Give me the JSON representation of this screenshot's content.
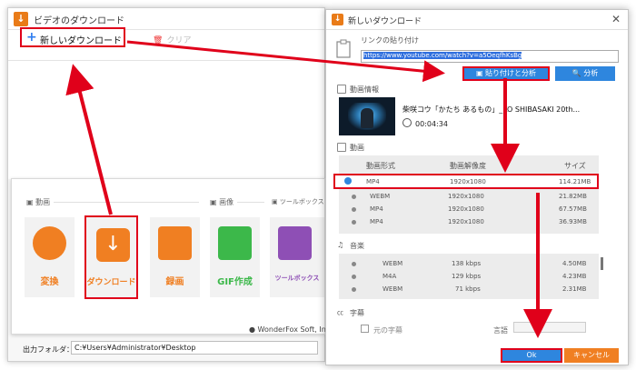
{
  "app_window": {
    "title": "ビデオのダウンロード",
    "toolbar": {
      "new_download": "新しいダウンロード",
      "clear": "クリア"
    },
    "sections": {
      "video": "動画",
      "image": "画像",
      "toolbox": "ツールボックス"
    },
    "tiles": [
      {
        "label": "変換"
      },
      {
        "label": "ダウンロード"
      },
      {
        "label": "録画"
      },
      {
        "label": "GIF作成"
      },
      {
        "label": "ツールボックス"
      }
    ],
    "credit": "WonderFox Soft, In",
    "output_folder_label": "出力フォルダ：",
    "output_folder_value": "C:¥Users¥Administrator¥Desktop"
  },
  "dialog": {
    "title": "新しいダウンロード",
    "url_label": "リンクの貼り付け",
    "url_value": "https://www.youtube.com/watch?v=a5OeqfhKsBg",
    "paste_analyze": "貼り付けと分析",
    "analyze": "分析",
    "video_info_label": "動画情報",
    "video_title": "柴咲コウ「かたち あるもの」_KO SHIBASAKI 20th...",
    "duration": "00:04:34",
    "video_section": "動画",
    "video_columns": [
      "動画形式",
      "動画解像度",
      "サイズ"
    ],
    "video_rows": [
      {
        "format": "MP4",
        "resolution": "1920x1080",
        "size": "114.21MB"
      },
      {
        "format": "WEBM",
        "resolution": "1920x1080",
        "size": "21.82MB"
      },
      {
        "format": "MP4",
        "resolution": "1920x1080",
        "size": "67.57MB"
      },
      {
        "format": "MP4",
        "resolution": "1920x1080",
        "size": "36.93MB"
      }
    ],
    "audio_section": "音楽",
    "audio_rows": [
      {
        "format": "WEBM",
        "bitrate": "138 kbps",
        "size": "4.50MB"
      },
      {
        "format": "M4A",
        "bitrate": "129 kbps",
        "size": "4.23MB"
      },
      {
        "format": "WEBM",
        "bitrate": "71 kbps",
        "size": "2.31MB"
      }
    ],
    "subtitle_section": "字幕",
    "original_subtitle": "元の字幕",
    "language_label": "言語",
    "ok": "Ok",
    "cancel": "キャンセル"
  },
  "colors": {
    "accent_blue": "#2e86de",
    "highlight_red": "#e0001a",
    "brand_orange": "#f07f22"
  }
}
